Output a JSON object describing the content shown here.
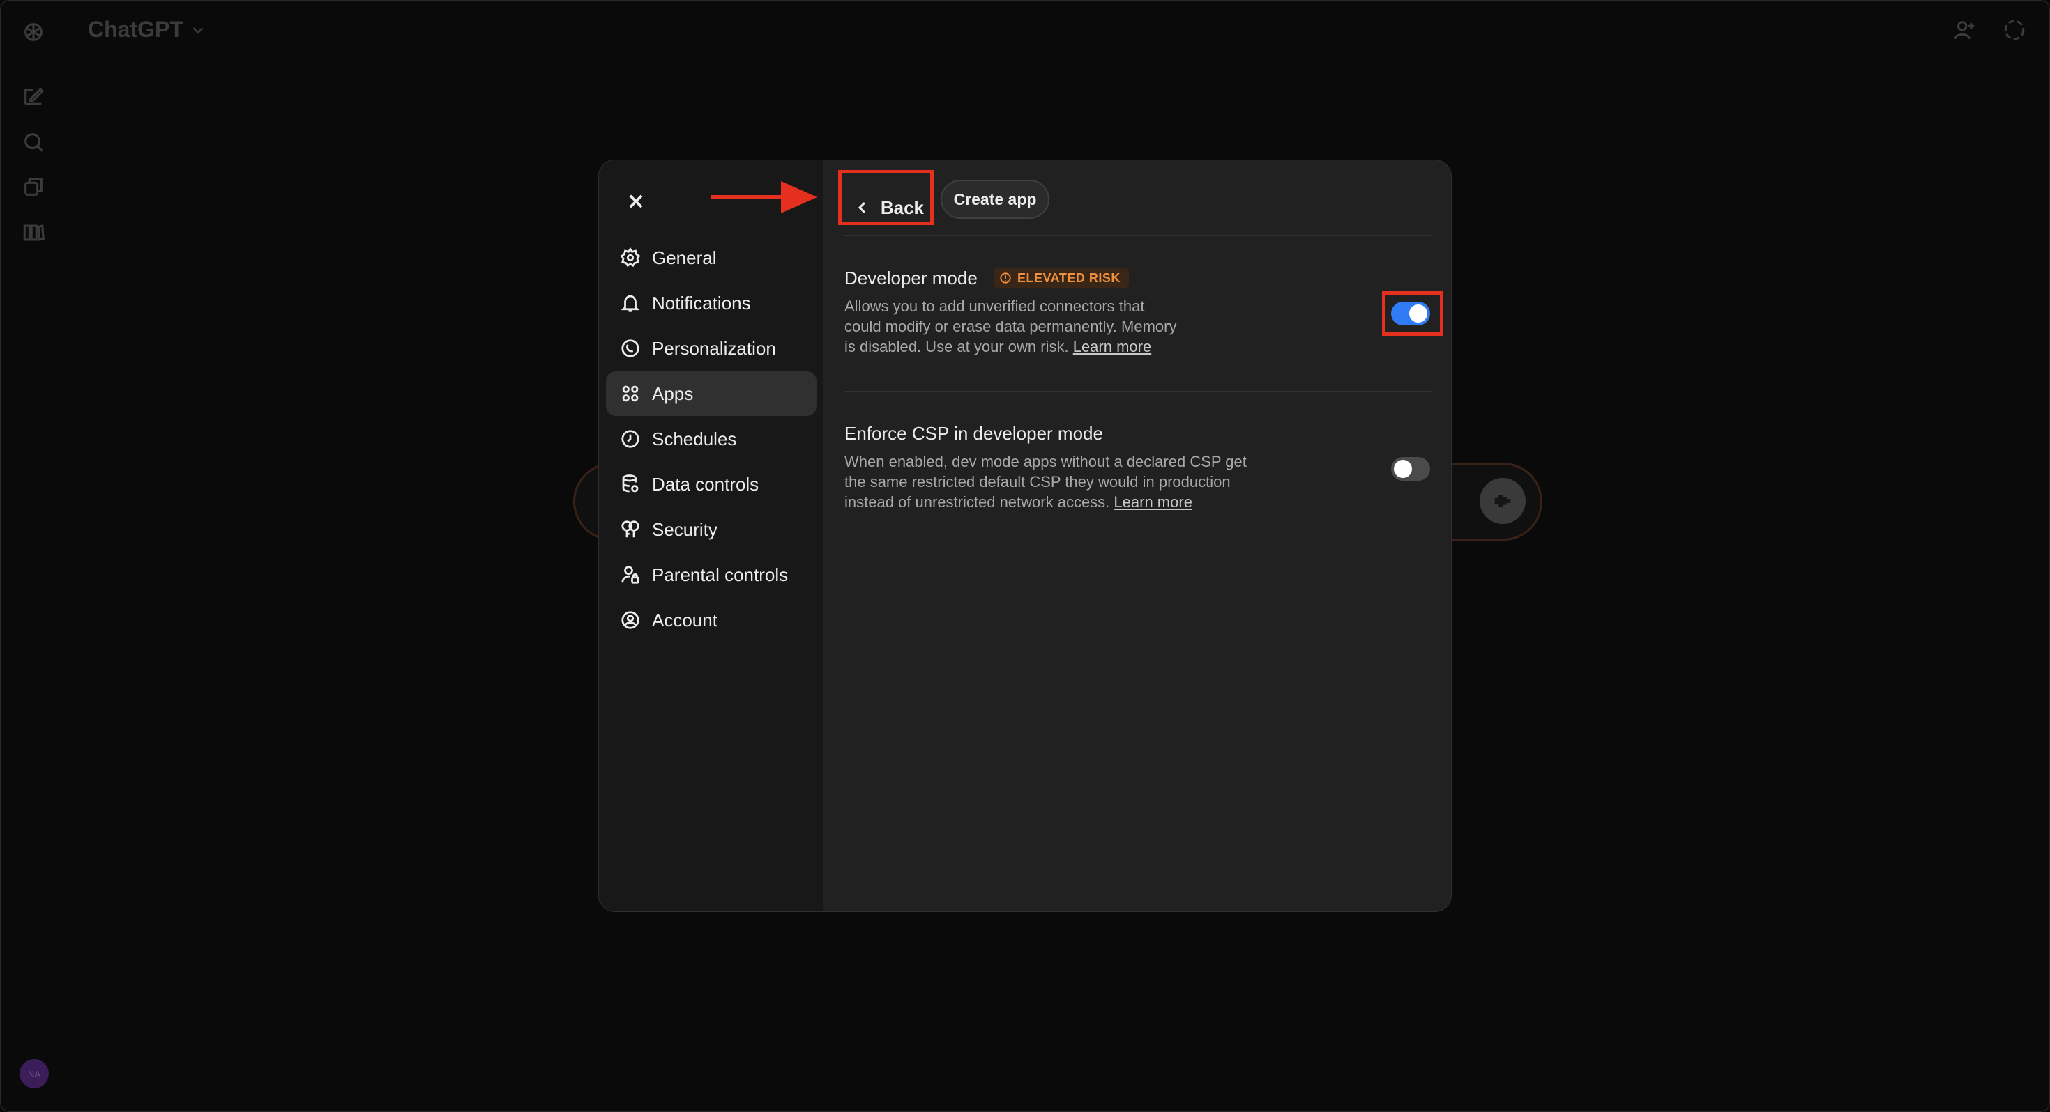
{
  "app": {
    "title": "ChatGPT"
  },
  "icons": {
    "logo": "openai-logo-icon",
    "new_chat": "edit-icon",
    "search": "search-icon",
    "images": "images-icon",
    "library": "library-icon",
    "share": "add-person-icon",
    "temporary": "dashed-circle-icon",
    "voice": "waveform-icon"
  },
  "user": {
    "initials": "NA"
  },
  "settings": {
    "close_label": "close",
    "nav": [
      {
        "label": "General",
        "icon": "gear-icon"
      },
      {
        "label": "Notifications",
        "icon": "bell-icon"
      },
      {
        "label": "Personalization",
        "icon": "personalization-icon"
      },
      {
        "label": "Apps",
        "icon": "apps-grid-icon",
        "active": true
      },
      {
        "label": "Schedules",
        "icon": "clock-icon"
      },
      {
        "label": "Data controls",
        "icon": "database-icon"
      },
      {
        "label": "Security",
        "icon": "key-icon"
      },
      {
        "label": "Parental controls",
        "icon": "person-lock-icon"
      },
      {
        "label": "Account",
        "icon": "account-circle-icon"
      }
    ],
    "header": {
      "back_label": "Back",
      "create_label": "Create app"
    },
    "developer_mode": {
      "title": "Developer mode",
      "badge": "ELEVATED RISK",
      "desc_line1": "Allows you to add unverified connectors that",
      "desc_line2": "could modify or erase data permanently. Memory",
      "desc_line3": "is disabled. Use at your own risk.",
      "link": "Learn more",
      "enabled": true
    },
    "enforce_csp": {
      "title": "Enforce CSP in developer mode",
      "desc_line1": "When enabled, dev mode apps without a declared CSP get",
      "desc_line2": "the same restricted default CSP they would in production",
      "desc_line3": "instead of unrestricted network access.",
      "link": "Learn more",
      "enabled": false
    }
  },
  "colors": {
    "annotation": "#e5301f",
    "toggle_on": "#2f7cf6",
    "badge_text": "#f0913e"
  }
}
